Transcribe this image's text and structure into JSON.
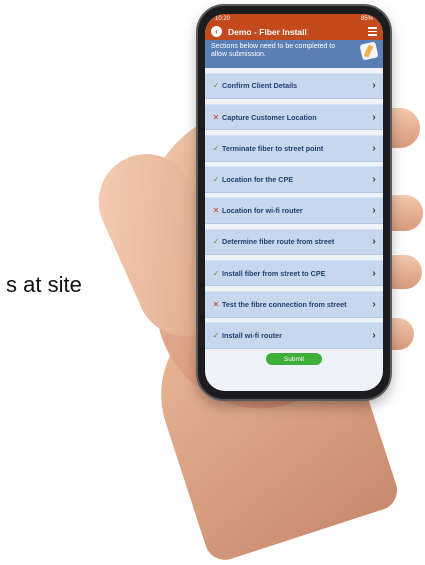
{
  "background": {
    "text": "s at site"
  },
  "status_bar": {
    "time": "10:20",
    "battery": "85%"
  },
  "header": {
    "title": "Demo - Fiber Install"
  },
  "notice": {
    "text": "Sections below need to be completed to allow submission."
  },
  "items": [
    {
      "label": "Confirm Client Details",
      "status": "complete"
    },
    {
      "label": "Capture Customer Location",
      "status": "incomplete"
    },
    {
      "label": "Terminate fiber to street point",
      "status": "complete"
    },
    {
      "label": "Location for the CPE",
      "status": "complete"
    },
    {
      "label": "Location for wi-fi router",
      "status": "incomplete"
    },
    {
      "label": "Determine fiber route from street",
      "status": "complete"
    },
    {
      "label": "Install fiber from street to CPE",
      "status": "complete"
    },
    {
      "label": "Test the fibre connection from street",
      "status": "incomplete"
    },
    {
      "label": "Install wi-fi router",
      "status": "complete"
    }
  ],
  "icons": {
    "complete": "check-icon",
    "incomplete": "cross-icon",
    "chevron": "chevron-right-icon"
  },
  "colors": {
    "header": "#c24a1c",
    "notice": "#5b7fb5",
    "item": "#c7d8ee",
    "submit": "#3fae38"
  },
  "submit": {
    "label": "Submit"
  }
}
